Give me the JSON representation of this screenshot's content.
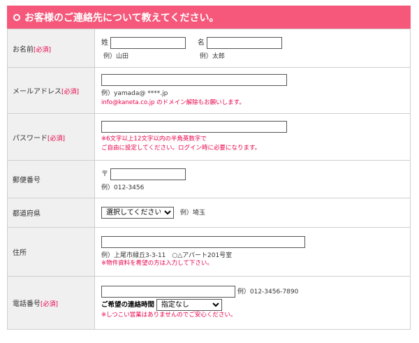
{
  "header": {
    "title": "お客様のご連絡先について教えてください。"
  },
  "fields": {
    "name": {
      "label": "お名前",
      "required": "[必須]",
      "last_label": "姓",
      "last_example": "例）山田",
      "last_value": "",
      "first_label": "名",
      "first_example": "例）太郎",
      "first_value": ""
    },
    "email": {
      "label": "メールアドレス",
      "required": "[必須]",
      "value": "",
      "example": "例）yamada@ ****.jp",
      "note": "info@kaneta.co.jp のドメイン解除もお願いします。"
    },
    "password": {
      "label": "パスワード",
      "required": "[必須]",
      "value": "",
      "note1": "※6文字以上12文字以内の半角英数字で",
      "note2": "ご自由に設定してください。ログイン時に必要になります。"
    },
    "zip": {
      "label": "郵便番号",
      "mark": "〒",
      "value": "",
      "example": "例）012-3456"
    },
    "prefecture": {
      "label": "都道府県",
      "selected": "選択してください",
      "example": "例）埼玉"
    },
    "address": {
      "label": "住所",
      "value": "",
      "example": "例）上尾市緑丘3-3-11　○△アパート201号室",
      "note": "※物件資料を希望の方は入力して下さい。"
    },
    "phone": {
      "label": "電話番号",
      "required": "[必須]",
      "value": "",
      "example": "例）012-3456-7890",
      "time_label": "ご希望の連絡時間",
      "time_selected": "指定なし",
      "note": "※しつこい営業はありませんのでご安心ください。"
    }
  },
  "colors": {
    "header_bg": "#f5587a",
    "accent_red": "#e8004a",
    "label_bg": "#f0f0f0"
  }
}
